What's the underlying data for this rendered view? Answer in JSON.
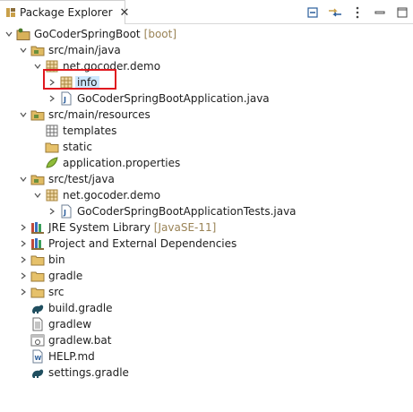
{
  "tab": {
    "title": "Package Explorer",
    "close": "✕",
    "icon": "package-explorer-icon"
  },
  "toolbar": [
    {
      "name": "collapse-all-icon"
    },
    {
      "name": "link-with-editor-icon"
    },
    {
      "name": "view-menu-icon"
    },
    {
      "name": "minimize-icon"
    },
    {
      "name": "maximize-icon"
    }
  ],
  "tree": [
    {
      "label": "GoCoderSpringBoot",
      "decoration": "[boot]",
      "icon": "project-icon",
      "toggle": "expanded"
    },
    {
      "label": "src/main/java",
      "icon": "source-folder-icon",
      "toggle": "expanded"
    },
    {
      "label": "net.gocoder.demo",
      "icon": "package-icon",
      "toggle": "expanded"
    },
    {
      "label": "info",
      "icon": "package-icon",
      "toggle": "collapsed",
      "selected": true
    },
    {
      "label": "GoCoderSpringBootApplication.java",
      "icon": "java-file-icon",
      "toggle": "collapsed"
    },
    {
      "label": "src/main/resources",
      "icon": "source-folder-icon",
      "toggle": "expanded"
    },
    {
      "label": "templates",
      "icon": "empty-package-icon",
      "toggle": "none"
    },
    {
      "label": "static",
      "icon": "folder-icon",
      "toggle": "none"
    },
    {
      "label": "application.properties",
      "icon": "properties-file-icon",
      "toggle": "none"
    },
    {
      "label": "src/test/java",
      "icon": "source-folder-icon",
      "toggle": "expanded"
    },
    {
      "label": "net.gocoder.demo",
      "icon": "package-icon",
      "toggle": "expanded"
    },
    {
      "label": "GoCoderSpringBootApplicationTests.java",
      "icon": "java-file-icon",
      "toggle": "collapsed"
    },
    {
      "label": "JRE System Library",
      "decoration": "[JavaSE-11]",
      "icon": "library-icon",
      "toggle": "collapsed"
    },
    {
      "label": "Project and External Dependencies",
      "icon": "library-icon",
      "toggle": "collapsed"
    },
    {
      "label": "bin",
      "icon": "folder-icon",
      "toggle": "collapsed"
    },
    {
      "label": "gradle",
      "icon": "folder-icon",
      "toggle": "collapsed"
    },
    {
      "label": "src",
      "icon": "folder-icon",
      "toggle": "collapsed"
    },
    {
      "label": "build.gradle",
      "icon": "gradle-file-icon",
      "toggle": "none"
    },
    {
      "label": "gradlew",
      "icon": "text-file-icon",
      "toggle": "none"
    },
    {
      "label": "gradlew.bat",
      "icon": "bat-file-icon",
      "toggle": "none"
    },
    {
      "label": "HELP.md",
      "icon": "markdown-file-icon",
      "toggle": "none"
    },
    {
      "label": "settings.gradle",
      "icon": "gradle-file-icon",
      "toggle": "none"
    }
  ],
  "colors": {
    "highlight": "#e0191f",
    "selection": "#cde8ff",
    "decoration": "#9a8356"
  }
}
